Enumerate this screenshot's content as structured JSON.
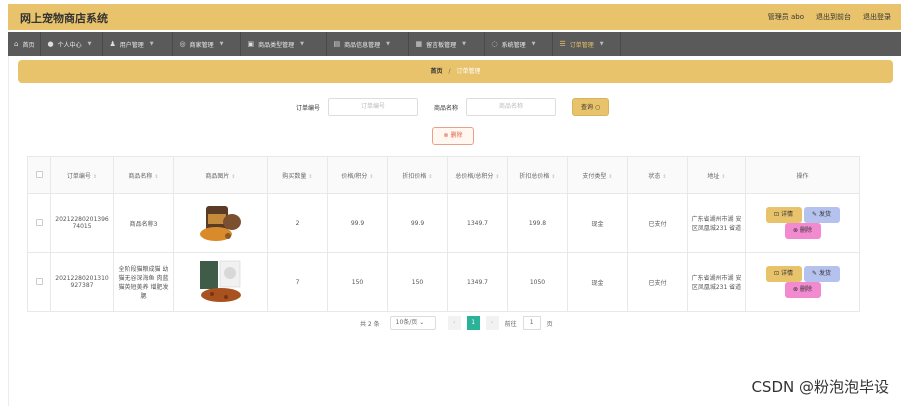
{
  "app": {
    "title": "网上宠物商店系统"
  },
  "top_links": {
    "user": "管理员 abo",
    "front": "退出到前台",
    "logout": "退出登录"
  },
  "nav": [
    {
      "icon": "home-icon",
      "label": "首页"
    },
    {
      "icon": "user-icon",
      "label": "个人中心"
    },
    {
      "icon": "users-icon",
      "label": "用户管理"
    },
    {
      "icon": "store-icon",
      "label": "商家管理"
    },
    {
      "icon": "category-icon",
      "label": "商品类型管理"
    },
    {
      "icon": "goods-icon",
      "label": "商品信息管理"
    },
    {
      "icon": "report-icon",
      "label": "留言板管理"
    },
    {
      "icon": "system-icon",
      "label": "系统管理"
    },
    {
      "icon": "order-icon",
      "label": "订单管理"
    }
  ],
  "breadcrumb": {
    "home": "首页",
    "sep": "/",
    "current": "订单管理"
  },
  "search": {
    "order_no_label": "订单编号",
    "order_no_placeholder": "订单编号",
    "goods_name_label": "商品名称",
    "goods_name_placeholder": "商品名称",
    "query_button": "查询 ○"
  },
  "delete_button": "⊗ 删除",
  "table": {
    "headers": [
      "订单编号",
      "商品名称",
      "商品图片",
      "购买数量",
      "价格/积分",
      "折扣价格",
      "总价格/总积分",
      "折扣总价格",
      "支付类型",
      "状态",
      "地址",
      "操作"
    ],
    "rows": [
      {
        "order_no": "20212280201396 74015",
        "goods_name": "商品名称3",
        "qty": "2",
        "price": "99.9",
        "discount_price": "99.9",
        "total": "1349.7",
        "discount_total": "199.8",
        "pay_type": "现金",
        "status": "已支付",
        "address": "广东省湖州市湖 安区凤凰城231 省道",
        "image": "pet-food-bag"
      },
      {
        "order_no": "20212280201310 927387",
        "goods_name": "全阶段猫粮成猫 幼猫无谷深海鱼 肉蓝猫英短美养 增肥发腮",
        "qty": "7",
        "price": "150",
        "discount_price": "150",
        "total": "1349.7",
        "discount_total": "1050",
        "pay_type": "现金",
        "status": "已支付",
        "address": "广东省湖州市湖 安区凤凰城231 省道",
        "image": "cat-food-package"
      }
    ],
    "actions": {
      "detail": "⊡ 详情",
      "ship": "✎ 发货",
      "delete": "⊗ 删除"
    }
  },
  "pager": {
    "total": "共 2 条",
    "page_size": "10条/页",
    "current_page": "1",
    "goto_label": "前往",
    "goto_value": "1",
    "page_unit": "页"
  },
  "watermark": "CSDN @粉泡泡毕设",
  "colors": {
    "accent": "#e8c36b",
    "nav_bg": "#5a5a5a",
    "page_active": "#2bb39a"
  }
}
